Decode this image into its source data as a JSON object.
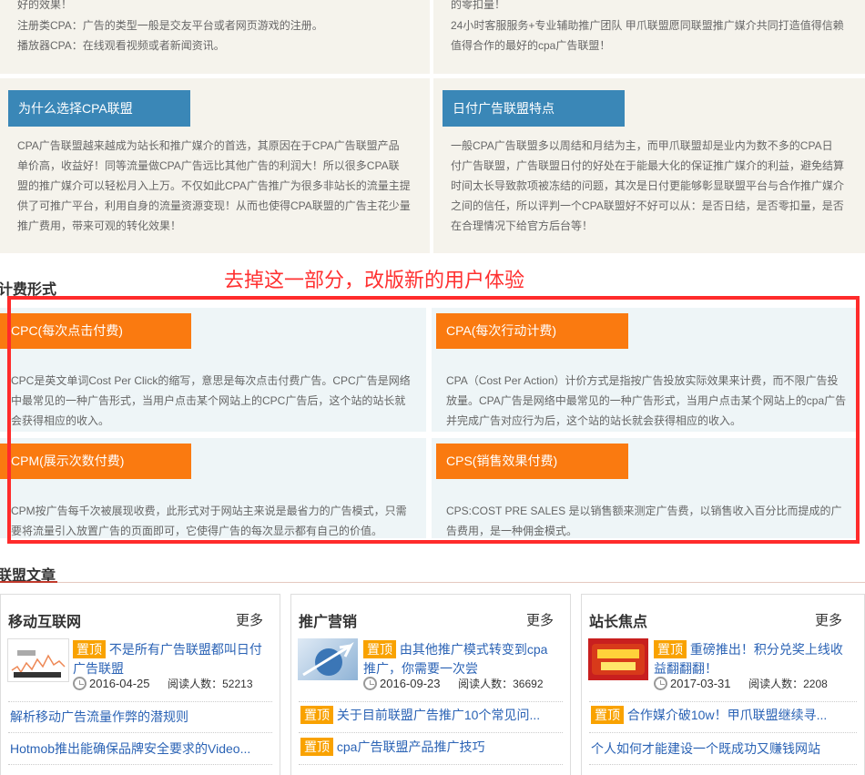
{
  "top_left": {
    "line1": "好的效果！",
    "line2": "注册类CPA：广告的类型一般是交友平台或者网页游戏的注册。",
    "line3": "播放器CPA：在线观看视频或者新闻资讯。"
  },
  "top_right": {
    "line1": "的零扣量！",
    "line2": "24小时客服服务+专业辅助推广团队 甲爪联盟愿同联盟推广媒介共同打造值得信赖",
    "line3": "值得合作的最好的cpa广告联盟！"
  },
  "why_cpa": {
    "title": "为什么选择CPA联盟",
    "lines": [
      "CPA广告联盟越来越成为站长和推广媒介的首选，其原因在于CPA广告联盟产品",
      "单价高，收益好！同等流量做CPA广告远比其他广告的利润大！所以很多CPA联",
      "盟的推广媒介可以轻松月入上万。不仅如此CPA广告推广为很多非站长的流量主提",
      "供了可推广平台，利用自身的流量资源变现！从而也使得CPA联盟的广告主花少量",
      "推广费用，带来可观的转化效果！"
    ]
  },
  "daily_pay": {
    "title": "日付广告联盟特点",
    "lines": [
      "一般CPA广告联盟多以周结和月结为主，而甲爪联盟却是业内为数不多的CPA日",
      "付广告联盟，广告联盟日付的好处在于能最大化的保证推广媒介的利益，避免结算",
      "时间太长导致款项被冻结的问题，其次是日付更能够彰显联盟平台与合作推广媒介",
      "之间的信任，所以评判一个CPA联盟好不好可以从：是否日结，是否零扣量，是否",
      "在合理情况下给官方后台等！"
    ]
  },
  "billing_heading": "计费形式",
  "annotation": "去掉这一部分，改版新的用户体验",
  "billing": {
    "cpc": {
      "title": "CPC(每次点击付费)",
      "lines": [
        "CPC是英文单词Cost Per Click的缩写，意思是每次点击付费广告。CPC广告是网络",
        "中最常见的一种广告形式，当用户点击某个网站上的CPC广告后，这个站的站长就",
        "会获得相应的收入。"
      ]
    },
    "cpa": {
      "title": "CPA(每次行动计费)",
      "lines": [
        "CPA（Cost Per Action）计价方式是指按广告投放实际效果来计费，而不限广告投",
        "放量。CPA广告是网络中最常见的一种广告形式，当用户点击某个网站上的cpa广告",
        "并完成广告对应行为后，这个站的站长就会获得相应的收入。"
      ]
    },
    "cpm": {
      "title": "CPM(展示次数付费)",
      "lines": [
        "CPM按广告每千次被展现收费，此形式对于网站主来说是最省力的广告模式，只需",
        "要将流量引入放置广告的页面即可，它使得广告的每次显示都有自己的价值。"
      ]
    },
    "cps": {
      "title": "CPS(销售效果付费)",
      "lines": [
        "CPS:COST PRE SALES 是以销售额来测定广告费，以销售收入百分比而提成的广",
        "告费用，是一种佣金模式。"
      ]
    }
  },
  "articles_heading": "联盟文章",
  "columns": [
    {
      "title": "移动互联网",
      "more": "更多",
      "badge": "置顶",
      "featured_title": "不是所有广告联盟都叫日付广告联盟",
      "date": "2016-04-25",
      "reads": "阅读人数：52213",
      "items": [
        {
          "badge": "",
          "text": "解析移动广告流量作弊的潜规则"
        },
        {
          "badge": "",
          "text": "Hotmob推出能确保品牌安全要求的Video..."
        }
      ]
    },
    {
      "title": "推广营销",
      "more": "更多",
      "badge": "置顶",
      "featured_title": "由其他推广模式转变到cpa推广，你需要一次尝",
      "date": "2016-09-23",
      "reads": "阅读人数：36692",
      "items": [
        {
          "badge": "置顶",
          "text": "关于目前联盟广告推广10个常见问..."
        },
        {
          "badge": "置顶",
          "text": "cpa广告联盟产品推广技巧"
        }
      ]
    },
    {
      "title": "站长焦点",
      "more": "更多",
      "badge": "置顶",
      "featured_title": "重磅推出！积分兑奖上线收益翻翻翻！",
      "date": "2017-03-31",
      "reads": "阅读人数：2208",
      "items": [
        {
          "badge": "置顶",
          "text": "合作媒介破10w！甲爪联盟继续寻..."
        },
        {
          "badge": "",
          "text": "个人如何才能建设一个既成功又赚钱网站"
        }
      ]
    }
  ],
  "colors": {
    "blue_tag": "#3a87b7",
    "orange_tag": "#fa7a10",
    "annotation_red": "#ff2b2b",
    "link_blue": "#2b63b5",
    "top_badge": "#f9a200"
  },
  "icons": [
    "clock-icon"
  ]
}
